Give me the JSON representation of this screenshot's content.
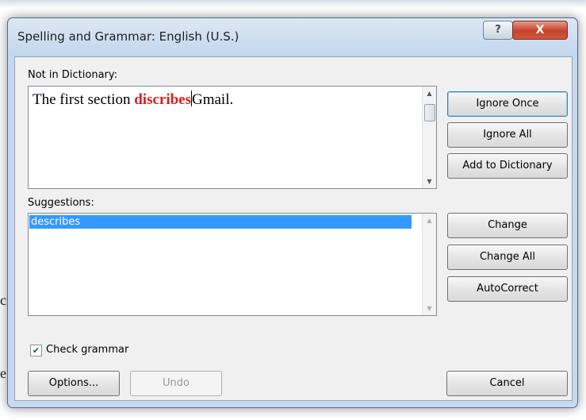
{
  "dialog": {
    "title": "Spelling and Grammar: English (U.S.)",
    "help_label": "?",
    "close_label": "X"
  },
  "not_in_dictionary": {
    "label": "Not in Dictionary:",
    "text_before": "The first section ",
    "error_word": "discribes",
    "text_after": "Gmail."
  },
  "suggestions": {
    "label": "Suggestions:",
    "items": [
      "describes"
    ]
  },
  "buttons": {
    "ignore_once": "Ignore Once",
    "ignore_all": "Ignore All",
    "add_to_dictionary": "Add to Dictionary",
    "change": "Change",
    "change_all": "Change All",
    "autocorrect": "AutoCorrect",
    "options": "Options...",
    "undo": "Undo",
    "cancel": "Cancel"
  },
  "check_grammar": {
    "label": "Check grammar",
    "checked": true
  },
  "background": {
    "fragment_1": "c",
    "fragment_2": "e"
  },
  "colors": {
    "error_word": "#e01b1b",
    "selection": "#3399ff"
  }
}
